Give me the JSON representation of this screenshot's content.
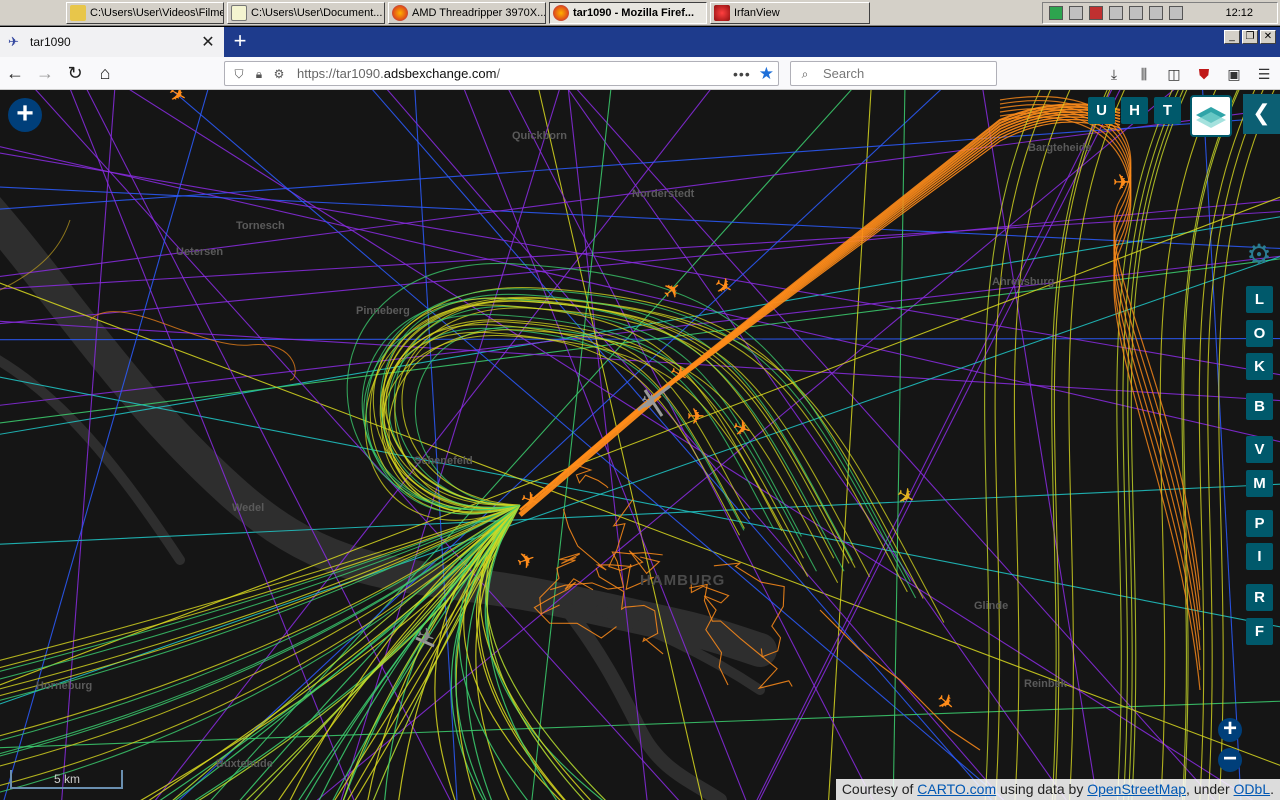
{
  "taskbar": {
    "tasks": [
      {
        "label": "C:\\Users\\User\\Videos\\Filme",
        "icon": "folder-icon",
        "active": false
      },
      {
        "label": "C:\\Users\\User\\Document...",
        "icon": "notepad-icon",
        "active": false
      },
      {
        "label": "AMD Threadripper 3970X...",
        "icon": "firefox-icon",
        "active": false
      },
      {
        "label": "tar1090 - Mozilla Firef...",
        "icon": "firefox-icon",
        "active": true
      },
      {
        "label": "IrfanView",
        "icon": "irfanview-icon",
        "active": false
      }
    ],
    "clock": "12:12"
  },
  "browser": {
    "tab_title": "tar1090",
    "url_prefix": "https://tar1090.",
    "url_domain": "adsbexchange.com",
    "url_suffix": "/",
    "search_placeholder": "Search"
  },
  "map": {
    "places": [
      {
        "name": "Quickborn",
        "cls": ""
      },
      {
        "name": "Norderstedt",
        "cls": ""
      },
      {
        "name": "Bargteheide",
        "cls": ""
      },
      {
        "name": "Tornesch",
        "cls": ""
      },
      {
        "name": "Uetersen",
        "cls": ""
      },
      {
        "name": "Pinneberg",
        "cls": ""
      },
      {
        "name": "Ahrensburg",
        "cls": ""
      },
      {
        "name": "Schenefeld",
        "cls": ""
      },
      {
        "name": "Wedel",
        "cls": ""
      },
      {
        "name": "HAMBURG",
        "cls": "city"
      },
      {
        "name": "Glinde",
        "cls": ""
      },
      {
        "name": "Reinbek",
        "cls": ""
      },
      {
        "name": "Horneburg",
        "cls": ""
      },
      {
        "name": "Buxtehude",
        "cls": ""
      }
    ],
    "top_buttons": [
      "U",
      "H",
      "T"
    ],
    "side_buttons": [
      "L",
      "O",
      "K",
      "B",
      "V",
      "M",
      "P",
      "I",
      "R",
      "F"
    ],
    "scale_label": "5 km",
    "attribution": {
      "prefix": "Courtesy of ",
      "carto": "CARTO.com",
      "middle": " using data by ",
      "osm": "OpenStreetMap",
      "under": ", under ",
      "odbl": "ODbL",
      "end": "."
    },
    "colors": {
      "purple": "#8a2be2",
      "blue": "#2c5cff",
      "green": "#3cd070",
      "yellow": "#d8d820",
      "orange": "#ff8c1a",
      "cyan": "#20c8c8"
    }
  }
}
